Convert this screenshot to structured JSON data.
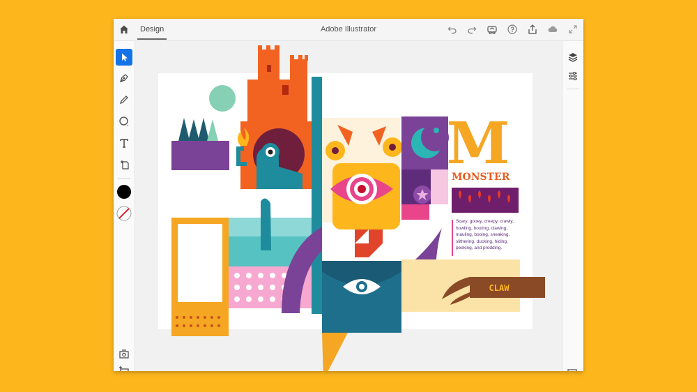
{
  "app": {
    "title": "Adobe Illustrator",
    "tab": "Design"
  },
  "artwork": {
    "big_letter": "M",
    "heading": "MONSTER",
    "description": "Scary, gooey, creepy, crawly, howling, hooting, clawing, mauling, booing, sneaking, slithering, ducking, hiding, peeking, and prodding.",
    "claw_label": "CLAW"
  },
  "colors": {
    "background": "#FDB71D",
    "accent": "#1473E6",
    "orange": "#F26322",
    "purple": "#7B4397",
    "teal": "#1E7A8C",
    "yellow": "#F5A623",
    "pink": "#E8458B"
  },
  "toolbar_icons": [
    "home-icon",
    "undo-icon",
    "redo-icon",
    "cloud-link-icon",
    "help-icon",
    "share-icon",
    "cloud-icon",
    "fullscreen-icon"
  ],
  "tools": [
    "selection-tool",
    "pen-tool",
    "pencil-tool",
    "shape-tool",
    "text-tool",
    "place-tool",
    "fill-swatch",
    "stroke-swatch",
    "capture-tool",
    "image-tool"
  ],
  "panels": [
    "layers-icon",
    "properties-icon",
    "artboards-icon"
  ]
}
